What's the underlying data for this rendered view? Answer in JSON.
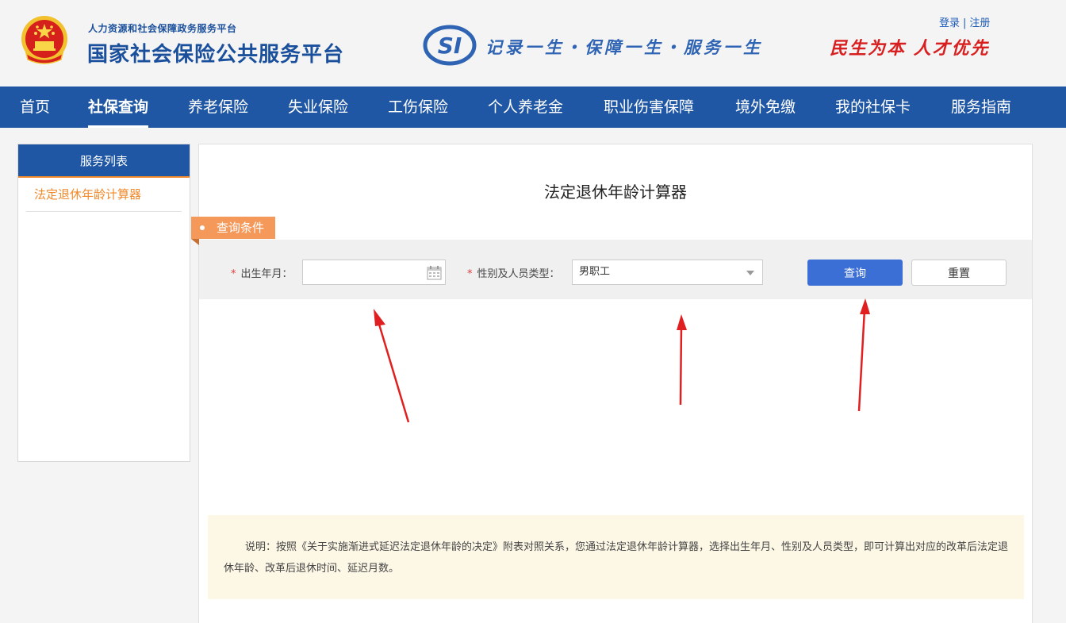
{
  "header": {
    "subtitle": "人力资源和社会保障政务服务平台",
    "title": "国家社会保险公共服务平台",
    "slogan": "记录一生・保障一生・服务一生",
    "motto": "民生为本 人才优先",
    "login_label": "登录",
    "register_label": "注册",
    "auth_separator": "|",
    "logo_text": "SI"
  },
  "nav": {
    "items": [
      {
        "label": "首页"
      },
      {
        "label": "社保查询"
      },
      {
        "label": "养老保险"
      },
      {
        "label": "失业保险"
      },
      {
        "label": "工伤保险"
      },
      {
        "label": "个人养老金"
      },
      {
        "label": "职业伤害保障"
      },
      {
        "label": "境外免缴"
      },
      {
        "label": "我的社保卡"
      },
      {
        "label": "服务指南"
      }
    ],
    "active_index": 1
  },
  "sidebar": {
    "title": "服务列表",
    "items": [
      {
        "label": "法定退休年龄计算器"
      }
    ]
  },
  "main": {
    "title": "法定退休年龄计算器",
    "conditions_tab": "查询条件",
    "form": {
      "birth_label": "出生年月：",
      "birth_value": "",
      "birth_placeholder": "",
      "type_label": "性别及人员类型：",
      "type_value": "男职工",
      "required_mark": "*",
      "query_button": "查询",
      "reset_button": "重置"
    },
    "note": "说明：按照《关于实施渐进式延迟法定退休年龄的决定》附表对照关系，您通过法定退休年龄计算器，选择出生年月、性别及人员类型，即可计算出对应的改革后法定退休年龄、改革后退休时间、延迟月数。"
  },
  "colors": {
    "brand_blue": "#1f57a5",
    "accent_orange": "#f08a2c",
    "query_button": "#3c6fd6",
    "annotation_arrow": "#e02020"
  }
}
